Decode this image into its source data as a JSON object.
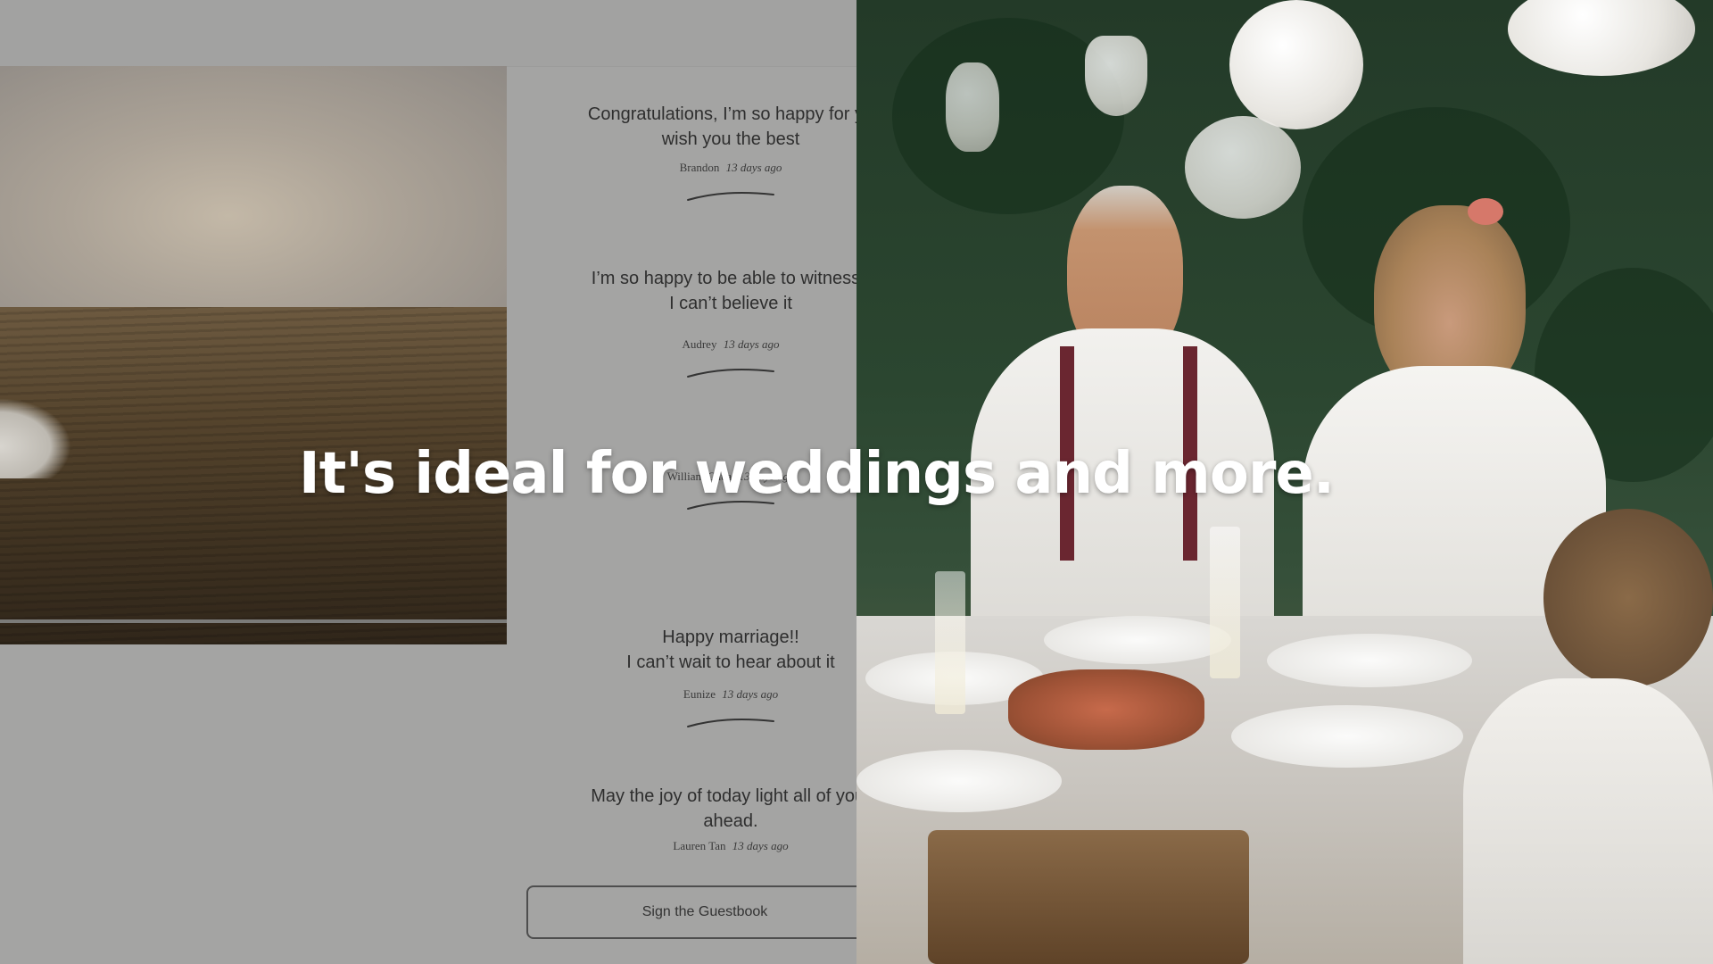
{
  "guestbook": {
    "entries": [
      {
        "message": "Congratulations, I’m so happy for yo\nwish you the best",
        "author": "Brandon",
        "time": "13 days ago"
      },
      {
        "message": "I’m so happy to be able to witness t\nI can’t believe it",
        "author": "Audrey",
        "time": "13 days ago"
      },
      {
        "message": "",
        "author": "William Chua",
        "time": "13 days ago"
      },
      {
        "message": "Happy marriage!!\nI can’t wait to hear about it",
        "author": "Eunize",
        "time": "13 days ago"
      },
      {
        "message": "May the joy of today light all of your\nahead.",
        "author": "Lauren Tan",
        "time": "13 days ago"
      }
    ],
    "sign_button_label": "Sign the Guestbook"
  },
  "caption": "It's ideal for weddings and more.",
  "colors": {
    "overlay_gray": "#a4a4a3",
    "caption_text": "#ffffff"
  }
}
